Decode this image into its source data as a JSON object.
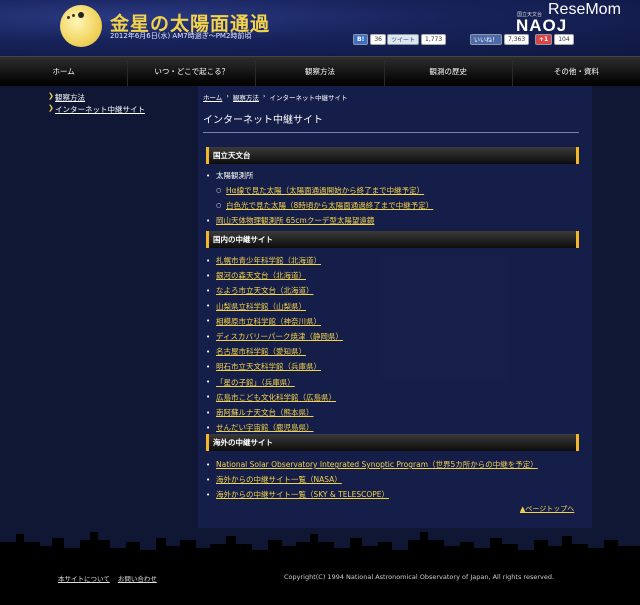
{
  "header": {
    "title": "金星の太陽面通過",
    "date": "2012年6月6日(水) AM7時過ぎ〜PM2時前頃",
    "naoj_small": "国立天文台",
    "naoj": "NAOJ",
    "watermark": "ReseMom"
  },
  "social": {
    "hatena_label": "B!",
    "hatena_count": "36",
    "tweet_label": "ツイート",
    "tweet_count": "1,773",
    "like_label": "いいね！",
    "like_count": "7,363",
    "gplus_label": "+1",
    "gplus_count": "104"
  },
  "nav": {
    "items": [
      "ホーム",
      "いつ・どこで起こる？",
      "観察方法",
      "観測の歴史",
      "その他・資料"
    ]
  },
  "sidebar": {
    "items": [
      "観察方法",
      "インターネット中継サイト"
    ]
  },
  "breadcrumb": {
    "home": "ホーム",
    "method": "観察方法",
    "current": "インターネット中継サイト",
    "sep": "›"
  },
  "page_title": "インターネット中継サイト",
  "sections": {
    "naoj": {
      "heading": "国立天文台",
      "group_label": "太陽観測所",
      "sub_links": [
        "Hα線で見た太陽（太陽面通過開始から終了まで中継予定）",
        "白色光で見た太陽（8時頃から太陽面通過終了まで中継予定）"
      ],
      "link": "岡山天体物理観測所 65cmクーデ型太陽望遠鏡"
    },
    "domestic": {
      "heading": "国内の中継サイト",
      "links": [
        "札幌市青少年科学館（北海道）",
        "銀河の森天文台（北海道）",
        "なよろ市立天文台（北海道）",
        "山梨県立科学館（山梨県）",
        "相模原市立科学館（神奈川県）",
        "ディスカバリーパーク焼津（静岡県）",
        "名古屋市科学館（愛知県）",
        "明石市立天文科学館（兵庫県）",
        "「星の子館」（兵庫県）",
        "広島市こども文化科学館（広島県）",
        "南阿蘇ルナ天文台（熊本県）",
        "せんだい宇宙館（鹿児島県）"
      ]
    },
    "overseas": {
      "heading": "海外の中継サイト",
      "links": [
        "National Solar Observatory Integrated Synoptic Program（世界5カ所からの中継を予定）",
        "海外からの中継サイト一覧（NASA）",
        "海外からの中継サイト一覧（SKY & TELESCOPE）"
      ]
    }
  },
  "page_top": "▲ページトップへ",
  "footer": {
    "about": "本サイトについて",
    "contact": "お問い合わせ",
    "copyright": "Copyright(C) 1994 National Astronomical Observatory of Japan, All rights reserved."
  },
  "colors": {
    "accent": "#f3d34b",
    "background": "#101734",
    "section_border": "#f3b52a"
  }
}
